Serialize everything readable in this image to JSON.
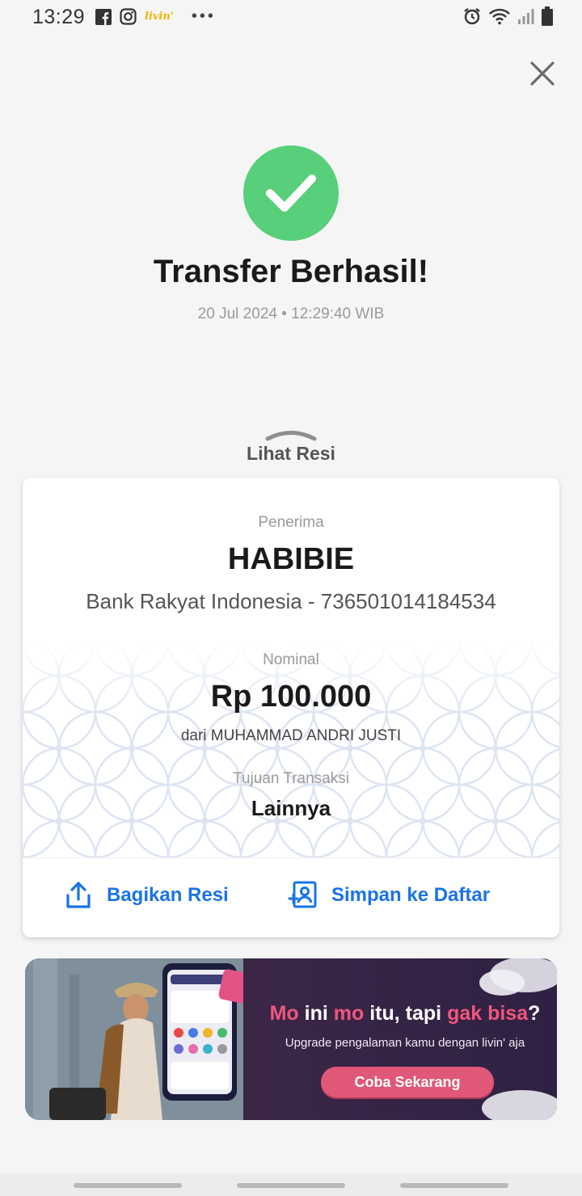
{
  "status_bar": {
    "time": "13:29",
    "left_icons": [
      "facebook-icon",
      "instagram-icon",
      "livin-app-icon"
    ],
    "livin_mini": "livin'",
    "more": "•••",
    "right_icons": [
      "alarm-icon",
      "wifi-icon",
      "signal-icon",
      "battery-icon"
    ]
  },
  "header": {
    "close_icon": "close-icon"
  },
  "result": {
    "title": "Transfer Berhasil!",
    "timestamp": "20 Jul 2024 • 12:29:40 WIB",
    "status_color": "#58cf7a"
  },
  "receipt_toggle": {
    "label": "Lihat Resi"
  },
  "receipt": {
    "recipient_label": "Penerima",
    "recipient_name": "HABIBIE",
    "recipient_bank": "Bank Rakyat Indonesia - 736501014184534",
    "amount_label": "Nominal",
    "amount": "Rp 100.000",
    "sender": "dari MUHAMMAD ANDRI JUSTI",
    "purpose_label": "Tujuan Transaksi",
    "purpose": "Lainnya"
  },
  "actions": {
    "share_label": "Bagikan Resi",
    "save_label": "Simpan ke Daftar",
    "accent_color": "#1a73e8"
  },
  "banner": {
    "headline_part1": "Mo ",
    "headline_part2": "ini",
    "headline_part3": " mo ",
    "headline_part4": "itu",
    "headline_part5": ", tapi ",
    "headline_part6": "gak bisa",
    "headline_part7": "?",
    "subline": "Upgrade pengalaman kamu dengan livin' aja",
    "cta": "Coba Sekarang"
  }
}
